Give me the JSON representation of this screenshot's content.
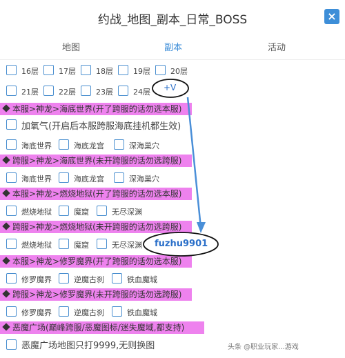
{
  "title": "约战_地图_副本_日常_BOSS",
  "close_label": "×",
  "tabs": [
    {
      "label": "地图"
    },
    {
      "label": "副本"
    },
    {
      "label": "活动"
    }
  ],
  "floors_row1": [
    {
      "label": "16层"
    },
    {
      "label": "17层"
    },
    {
      "label": "18层"
    },
    {
      "label": "19层"
    },
    {
      "label": "20层"
    }
  ],
  "floors_row2": [
    {
      "label": "21层"
    },
    {
      "label": "22层"
    },
    {
      "label": "23层"
    },
    {
      "label": "24层"
    }
  ],
  "annotation_plus_v": "+V",
  "annotation_id": "fuzhu9901",
  "sections": [
    {
      "heading": "本服>神龙>海底世界(开了跨服的话勿选本服)"
    },
    {
      "heading": "跨服>神龙>海底世界(未开跨服的话勿选跨服)"
    },
    {
      "heading": "本服>神龙>燃烧地狱(开了跨服的话勿选本服)"
    },
    {
      "heading": "跨服>神龙>燃烧地狱(未开跨服的话勿选跨服)"
    },
    {
      "heading": "本服>神龙>修罗魔界(开了跨服的话勿选本服)"
    },
    {
      "heading": "跨服>神龙>修罗魔界(未开跨服的话勿选跨服)"
    },
    {
      "heading": "恶魔广场(巅峰跨服/恶魔图标/迷失魔域,都支持)"
    }
  ],
  "oxygen_option": "加氧气(开启后本服跨服海底挂机都生效)",
  "undersea_maps": [
    "海底世界",
    "海底龙宫",
    "深海巢穴"
  ],
  "undersea_maps_cross": [
    "海底世界",
    "海底龙宫",
    "深海巢穴"
  ],
  "hell_maps": [
    "燃烧地狱",
    "魔窟",
    "无尽深渊"
  ],
  "hell_maps_cross": [
    "燃烧地狱",
    "魔窟",
    "无尽深渊"
  ],
  "shura_maps": [
    "修罗魔界",
    "逆魔古刹",
    "铁血魔城"
  ],
  "shura_maps_cross": [
    "修罗魔界",
    "逆魔古刹",
    "铁血魔城"
  ],
  "demon_square_option": "恶魔广场地图只打9999,无则换图",
  "watermark": "头条 @职业玩家...游戏"
}
